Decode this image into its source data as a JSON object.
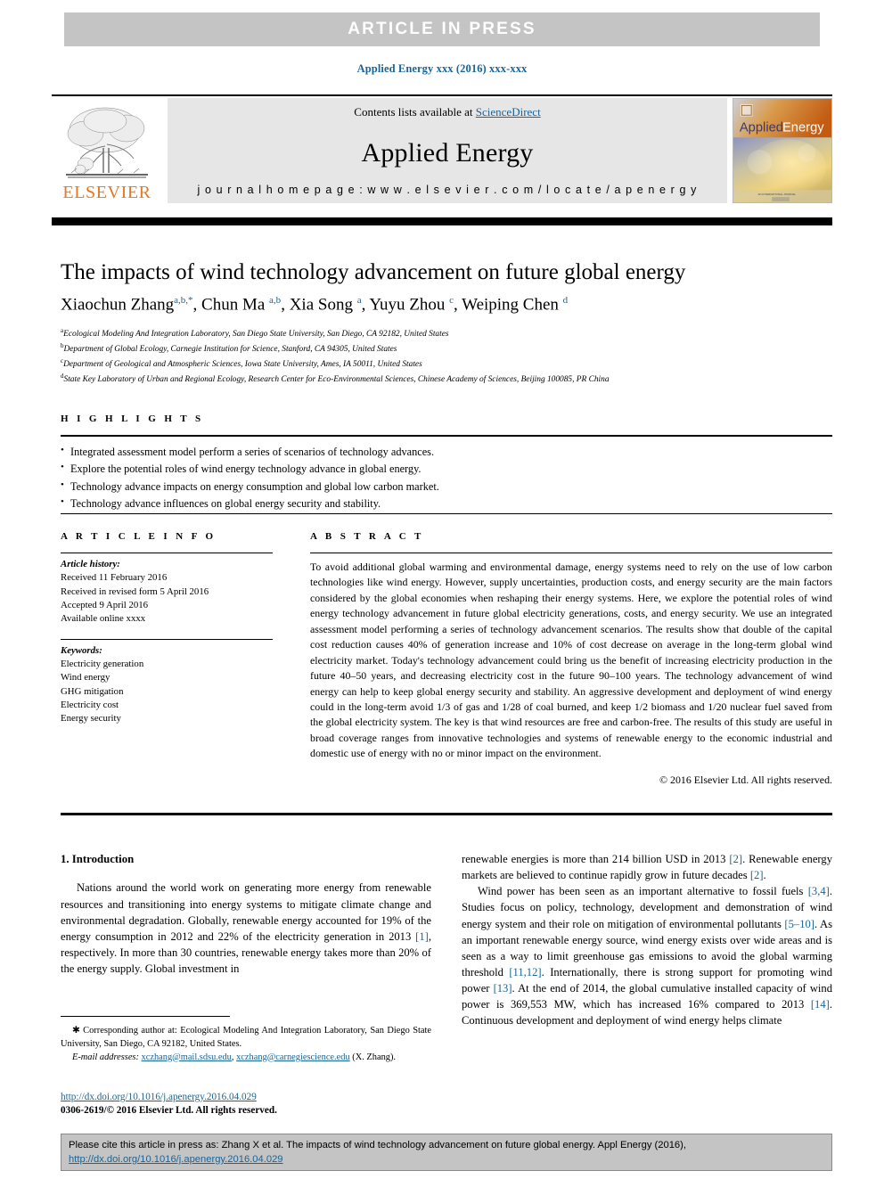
{
  "banner": {
    "text": "ARTICLE  IN  PRESS",
    "bg_color": "#c4c4c4"
  },
  "running_head": "Applied Energy xxx (2016) xxx-xxx",
  "masthead": {
    "contents_prefix": "Contents lists available at ",
    "sciencedirect": "ScienceDirect",
    "journal_title": "Applied Energy",
    "homepage": "j o u r n a l   h o m e p a g e :   w w w . e l s e v i e r . c o m / l o c a t e / a p e n e r g y",
    "publisher": "ELSEVIER",
    "cover_brand_applied": "Applied",
    "cover_brand_energy": "Energy",
    "link_color": "#1a6496",
    "publisher_color": "#e87722"
  },
  "article": {
    "title": "The impacts of wind technology advancement on future global energy",
    "authors_html": "Xiaochun Zhang<sup>a,b,*</sup>, Chun Ma <sup>a,b</sup>, Xia Song <sup>a</sup>, Yuyu Zhou <sup>c</sup>, Weiping Chen <sup>d</sup>",
    "affiliations": [
      {
        "marker": "a",
        "text": "Ecological Modeling And Integration Laboratory, San Diego State University, San Diego, CA 92182, United States"
      },
      {
        "marker": "b",
        "text": "Department of Global Ecology, Carnegie Institution for Science, Stanford, CA 94305, United States"
      },
      {
        "marker": "c",
        "text": "Department of Geological and Atmospheric Sciences, Iowa State University, Ames, IA 50011, United States"
      },
      {
        "marker": "d",
        "text": "State Key Laboratory of Urban and Regional Ecology, Research Center for Eco-Environmental Sciences, Chinese Academy of Sciences, Beijing 100085, PR China"
      }
    ]
  },
  "highlights": {
    "label": "H I G H L I G H T S",
    "items": [
      "Integrated assessment model perform a series of scenarios of technology advances.",
      "Explore the potential roles of wind energy technology advance in global energy.",
      "Technology advance impacts on energy consumption and global low carbon market.",
      "Technology advance influences on global energy security and stability."
    ]
  },
  "article_info": {
    "label": "A R T I C L E   I N F O",
    "history_label": "Article history:",
    "history": [
      "Received 11 February 2016",
      "Received in revised form 5 April 2016",
      "Accepted 9 April 2016",
      "Available online xxxx"
    ],
    "keywords_label": "Keywords:",
    "keywords": [
      "Electricity generation",
      "Wind energy",
      "GHG mitigation",
      "Electricity cost",
      "Energy security"
    ]
  },
  "abstract": {
    "label": "A B S T R A C T",
    "text": "To avoid additional global warming and environmental damage, energy systems need to rely on the use of low carbon technologies like wind energy. However, supply uncertainties, production costs, and energy security are the main factors considered by the global economies when reshaping their energy systems. Here, we explore the potential roles of wind energy technology advancement in future global electricity generations, costs, and energy security. We use an integrated assessment model performing a series of technology advancement scenarios. The results show that double of the capital cost reduction causes 40% of generation increase and 10% of cost decrease on average in the long-term global wind electricity market. Today's technology advancement could bring us the benefit of increasing electricity production in the future 40–50 years, and decreasing electricity cost in the future 90–100 years. The technology advancement of wind energy can help to keep global energy security and stability. An aggressive development and deployment of wind energy could in the long-term avoid 1/3 of gas and 1/28 of coal burned, and keep 1/2 biomass and 1/20 nuclear fuel saved from the global electricity system. The key is that wind resources are free and carbon-free. The results of this study are useful in broad coverage ranges from innovative technologies and systems of renewable energy to the economic industrial and domestic use of energy with no or minor impact on the environment.",
    "copyright": "© 2016 Elsevier Ltd. All rights reserved."
  },
  "body": {
    "section_heading": "1. Introduction",
    "left_column_html": "Nations around the world work on generating more energy from renewable resources and transitioning into energy systems to mitigate climate change and environmental degradation. Globally, renewable energy accounted for 19% of the energy consumption in 2012 and 22% of the electricity generation in 2013 <span class=\"ref\">[1]</span>, respectively. In more than 30 countries, renewable energy takes more than 20% of the energy supply. Global investment in",
    "right_column_html": "renewable energies is more than 214 billion USD in 2013 <span class=\"ref\">[2]</span>. Renewable energy markets are believed to continue rapidly grow in future decades <span class=\"ref\">[2]</span>.|Wind power has been seen as an important alternative to fossil fuels <span class=\"ref\">[3,4]</span>. Studies focus on policy, technology, development and demonstration of wind energy system and their role on mitigation of environmental pollutants <span class=\"ref\">[5–10]</span>. As an important renewable energy source, wind energy exists over wide areas and is seen as a way to limit greenhouse gas emissions to avoid the global warming threshold <span class=\"ref\">[11,12]</span>. Internationally, there is strong support for promoting wind power <span class=\"ref\">[13]</span>. At the end of 2014, the global cumulative installed capacity of wind power is 369,553 MW, which has increased 16% compared to 2013 <span class=\"ref\">[14]</span>. Continuous development and deployment of wind energy helps climate"
  },
  "footnotes": {
    "corresponding": "Corresponding author at: Ecological Modeling And Integration Laboratory, San Diego State University, San Diego, CA 92182, United States.",
    "email_label": "E-mail addresses:",
    "email_1": "xczhang@mail.sdsu.edu",
    "email_2": "xczhang@carnegiescience.edu",
    "email_suffix": "(X. Zhang).",
    "doi": "http://dx.doi.org/10.1016/j.apenergy.2016.04.029",
    "issn": "0306-2619/© 2016 Elsevier Ltd. All rights reserved."
  },
  "cite_box": {
    "text": "Please cite this article in press as: Zhang X et al. The impacts of wind technology advancement on future global energy. Appl Energy (2016), ",
    "link": "http://dx.doi.org/10.1016/j.apenergy.2016.04.029"
  }
}
